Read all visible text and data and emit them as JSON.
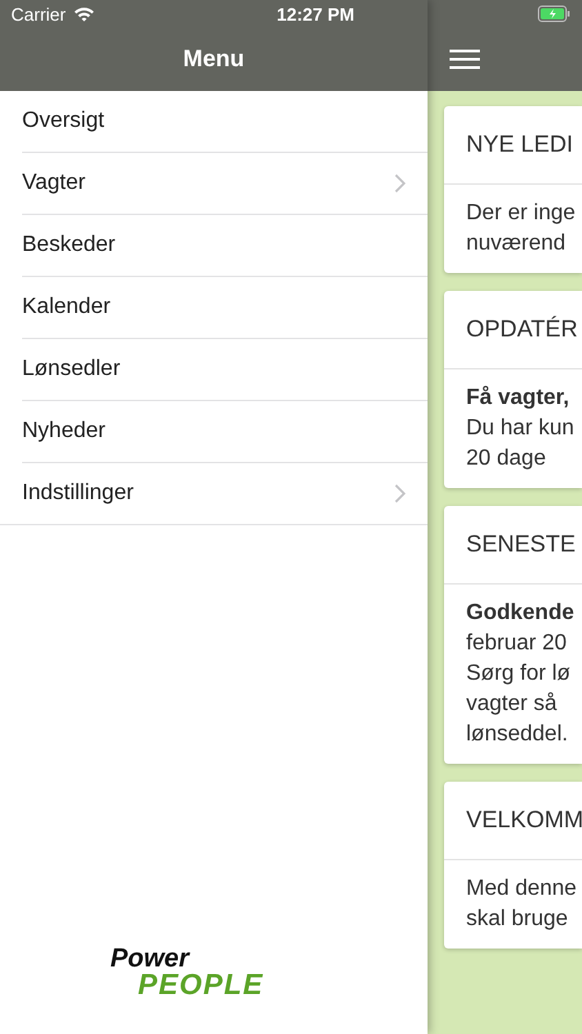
{
  "status_bar": {
    "carrier": "Carrier",
    "time": "12:27 PM"
  },
  "menu": {
    "title": "Menu",
    "items": [
      {
        "label": "Oversigt",
        "has_submenu": false
      },
      {
        "label": "Vagter",
        "has_submenu": true
      },
      {
        "label": "Beskeder",
        "has_submenu": false
      },
      {
        "label": "Kalender",
        "has_submenu": false
      },
      {
        "label": "Lønsedler",
        "has_submenu": false
      },
      {
        "label": "Nyheder",
        "has_submenu": false
      },
      {
        "label": "Indstillinger",
        "has_submenu": true
      }
    ]
  },
  "logo": {
    "line_1": "Power",
    "line_2": "PEOPLE"
  },
  "cards": [
    {
      "title": "NYE LEDI",
      "lines": [
        {
          "text": "Der er inge",
          "bold": false
        },
        {
          "text": "nuværend",
          "bold": false
        }
      ]
    },
    {
      "title": "OPDATÉR",
      "lines": [
        {
          "text": "Få vagter,",
          "bold": true
        },
        {
          "text": "Du har kun",
          "bold": false
        },
        {
          "text": "20 dage",
          "bold": false
        }
      ]
    },
    {
      "title": "SENESTE",
      "lines": [
        {
          "text": "Godkende",
          "bold": true
        },
        {
          "text": "februar 20",
          "bold": false
        },
        {
          "text": "Sørg for lø",
          "bold": false
        },
        {
          "text": "vagter så",
          "bold": false
        },
        {
          "text": "lønseddel.",
          "bold": false
        }
      ]
    },
    {
      "title": "VELKOMM",
      "lines": [
        {
          "text": "Med denne",
          "bold": false
        },
        {
          "text": "skal bruge",
          "bold": false
        }
      ]
    }
  ]
}
